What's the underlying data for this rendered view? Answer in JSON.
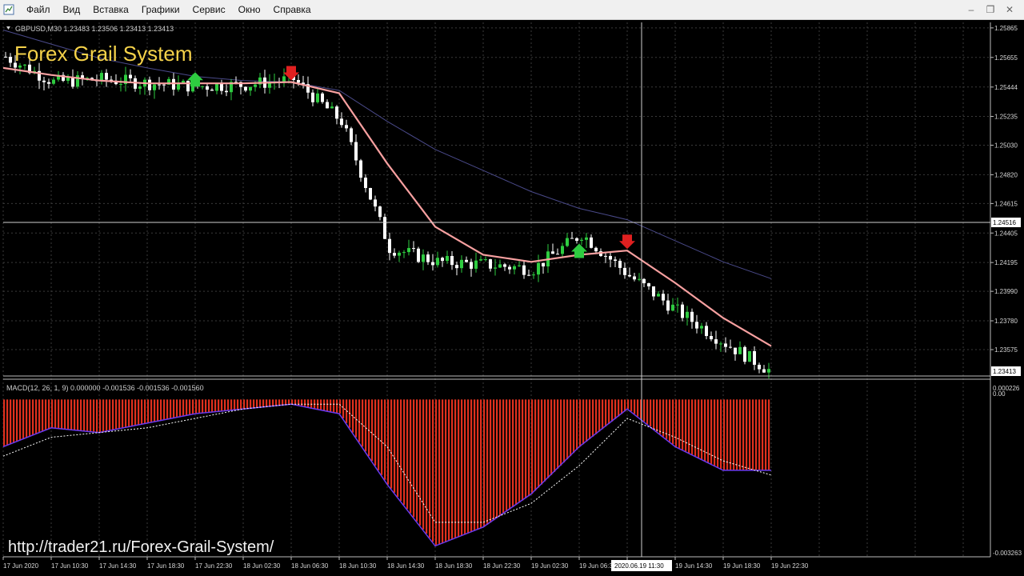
{
  "menu": [
    "Файл",
    "Вид",
    "Вставка",
    "Графики",
    "Сервис",
    "Окно",
    "Справка"
  ],
  "chart_header": "GBPUSD,M30  1.23483 1.23506 1.23413 1.23413",
  "overlay_title": "Forex Grail System",
  "macd_header": "MACD(12, 26, 1, 9) 0.000000 -0.001536 -0.001536 -0.001560",
  "url_text": "http://trader21.ru/Forex-Grail-System/",
  "price_axis_labels": [
    "1.25865",
    "1.25655",
    "1.25444",
    "1.25235",
    "1.25030",
    "1.24820",
    "1.24615",
    "1.24405",
    "1.24195",
    "1.23990",
    "1.23780",
    "1.23575"
  ],
  "current_price_label": "1.24516",
  "last_price_label": "1.23413",
  "macd_axis_labels": [
    "0.000226",
    "0.00",
    "-0.003263"
  ],
  "time_axis_labels": [
    "17 Jun 2020",
    "17 Jun 10:30",
    "17 Jun 14:30",
    "17 Jun 18:30",
    "17 Jun 22:30",
    "18 Jun 02:30",
    "18 Jun 06:30",
    "18 Jun 10:30",
    "18 Jun 14:30",
    "18 Jun 18:30",
    "18 Jun 22:30",
    "19 Jun 02:30",
    "19 Jun 06:30",
    "19 Jun 10:30",
    "19 Jun 14:30",
    "19 Jun 18:30",
    "19 Jun 22:30"
  ],
  "crosshair_time_label": "2020.06.19 11:30",
  "colors": {
    "background": "#000000",
    "grid": "#3a3a3a",
    "bull_candle": "#2ecc40",
    "bear_candle": "#ffffff",
    "fast_ma": "#f7a0a0",
    "slow_ma": "#4a4a8a",
    "macd_hist": "#e0301e",
    "signal_line": "#ffffff",
    "macd_line": "#6a3af0",
    "buy_arrow": "#2ecc40",
    "sell_arrow": "#e02020"
  },
  "chart_data": [
    {
      "type": "candlestick",
      "title": "GBPUSD,M30",
      "x": [
        "17 Jun 2020",
        "17 Jun 10:30",
        "17 Jun 14:30",
        "17 Jun 18:30",
        "17 Jun 22:30",
        "18 Jun 02:30",
        "18 Jun 06:30",
        "18 Jun 10:30",
        "18 Jun 14:30",
        "18 Jun 18:30",
        "18 Jun 22:30",
        "19 Jun 02:30",
        "19 Jun 06:30",
        "19 Jun 10:30",
        "19 Jun 14:30",
        "19 Jun 18:30",
        "19 Jun 22:30"
      ],
      "close_approx": [
        1.2566,
        1.2548,
        1.255,
        1.2547,
        1.2545,
        1.2546,
        1.255,
        1.252,
        1.243,
        1.242,
        1.2418,
        1.2415,
        1.244,
        1.241,
        1.2385,
        1.2362,
        1.2341
      ],
      "ylim": [
        1.2341,
        1.2587
      ],
      "series_ma": [
        {
          "values": [
            1.2558,
            1.2553,
            1.2549,
            1.2547,
            1.2547,
            1.2547,
            1.2548,
            1.254,
            1.249,
            1.2445,
            1.2425,
            1.242,
            1.2425,
            1.2428,
            1.2405,
            1.238,
            1.236
          ]
        },
        {
          "values": [
            1.2585,
            1.2575,
            1.2565,
            1.2558,
            1.2552,
            1.2549,
            1.2548,
            1.2542,
            1.252,
            1.25,
            1.2485,
            1.247,
            1.2458,
            1.245,
            1.2435,
            1.242,
            1.2408
          ]
        }
      ],
      "signals": [
        {
          "type": "sell",
          "x": "18 Jun 06:30"
        },
        {
          "type": "buy",
          "x": "17 Jun 22:30"
        },
        {
          "type": "buy",
          "x": "19 Jun 06:30"
        },
        {
          "type": "sell",
          "x": "19 Jun 10:30"
        }
      ]
    },
    {
      "type": "bar",
      "title": "MACD(12, 26, 1, 9)",
      "x": [
        "17 Jun 2020",
        "17 Jun 10:30",
        "17 Jun 14:30",
        "17 Jun 18:30",
        "17 Jun 22:30",
        "18 Jun 02:30",
        "18 Jun 06:30",
        "18 Jun 10:30",
        "18 Jun 14:30",
        "18 Jun 18:30",
        "18 Jun 22:30",
        "19 Jun 02:30",
        "19 Jun 06:30",
        "19 Jun 10:30",
        "19 Jun 14:30",
        "19 Jun 18:30",
        "19 Jun 22:30"
      ],
      "series": [
        {
          "values": [
            -0.001,
            -0.0006,
            -0.0007,
            -0.0005,
            -0.0003,
            -0.0002,
            -0.0001,
            -0.0003,
            -0.0018,
            -0.0031,
            -0.0027,
            -0.002,
            -0.001,
            -0.0002,
            -0.001,
            -0.0015,
            -0.0015
          ]
        },
        {
          "values": [
            -0.0012,
            -0.0008,
            -0.0007,
            -0.0006,
            -0.0004,
            -0.0002,
            -0.0001,
            -0.0001,
            -0.001,
            -0.0026,
            -0.0026,
            -0.0022,
            -0.0014,
            -0.0004,
            -0.0008,
            -0.0013,
            -0.0016
          ]
        }
      ],
      "ylim": [
        -0.003263,
        0.000226
      ]
    }
  ]
}
